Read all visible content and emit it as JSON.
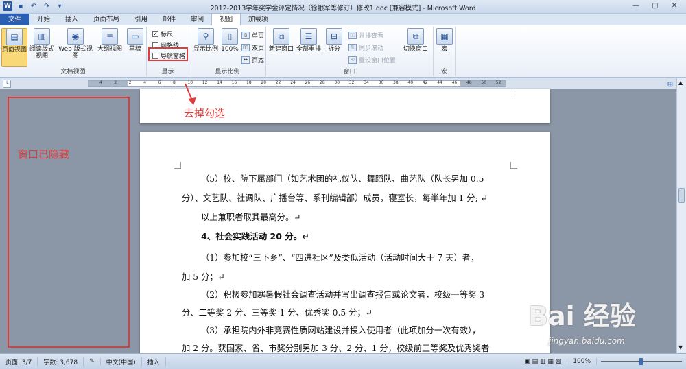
{
  "title_bar": {
    "title": "2012-2013学年奖学金评定情况（徐银军等修订）修改1.doc [兼容模式] - Microsoft Word",
    "minimize": "—",
    "restore": "▢",
    "close": "✕"
  },
  "tabs": [
    "文件",
    "开始",
    "插入",
    "页面布局",
    "引用",
    "邮件",
    "审阅",
    "视图",
    "加载项"
  ],
  "active_tab": "视图",
  "ribbon": {
    "doc_views": {
      "label": "文档视图",
      "items": [
        "页面视图",
        "阅读版式\n视图",
        "Web 版式视图",
        "大纲视图",
        "草稿"
      ]
    },
    "show": {
      "label": "显示",
      "ruler": "标尺",
      "gridlines": "网格线",
      "nav_pane": "导航窗格"
    },
    "zoom": {
      "label": "显示比例",
      "zoom": "显示比例",
      "hundred": "100%",
      "single": "单页",
      "double": "双页",
      "width": "页宽"
    },
    "window": {
      "label": "窗口",
      "new": "新建窗口",
      "arrange": "全部重排",
      "split": "拆分",
      "side": "并排查看",
      "sync": "同步滚动",
      "reset": "重设窗口位置",
      "switch": "切换窗口"
    },
    "macro": {
      "label": "宏",
      "macros": "宏"
    }
  },
  "ruler_ticks": [
    "4",
    "2",
    "2",
    "4",
    "6",
    "8",
    "10",
    "12",
    "14",
    "16",
    "18",
    "20",
    "22",
    "24",
    "26",
    "28",
    "30",
    "32",
    "34",
    "36",
    "38",
    "40",
    "42",
    "44",
    "46",
    "48",
    "50",
    "52"
  ],
  "annotations": {
    "uncheck": "去掉勾选",
    "hidden": "窗口已隐藏"
  },
  "document": {
    "lines": [
      "（5）校、院下属部门（如艺术团的礼仪队、舞蹈队、曲艺队（队长另加 0.5",
      "分）、文艺队、社调队、广播台等、系刊编辑部）成员，寝室长，每半年加 1 分; ↵",
      "以上兼职者取其最高分。↵",
      "4、社会实践活动 20 分。↵",
      "（1）参加校“三下乡”、“四进社区”及类似活动（活动时间大于 7 天）者，",
      "加 5 分；↵",
      "（2）积极参加寒暑假社会调查活动并写出调查报告或论文者，校级一等奖 3",
      "分、二等奖 2 分、三等奖 1 分、优秀奖 0.5 分；↵",
      "（3）承担院内外非竞赛性质网站建设并投入使用者（此项加分一次有效），",
      "加 2 分。获国家、省、市奖分别另加 3 分、2 分、1 分，校级前三等奖及优秀奖者"
    ]
  },
  "status_bar": {
    "page": "页面: 3/7",
    "words": "字数: 3,678",
    "lang": "中文(中国)",
    "mode": "插入",
    "zoom": "100%"
  },
  "watermark": {
    "brand": "Bai 经验",
    "url": "jingyan.baidu.com"
  },
  "colors": {
    "accent": "#2b579a",
    "annotation": "#e03b3b"
  }
}
